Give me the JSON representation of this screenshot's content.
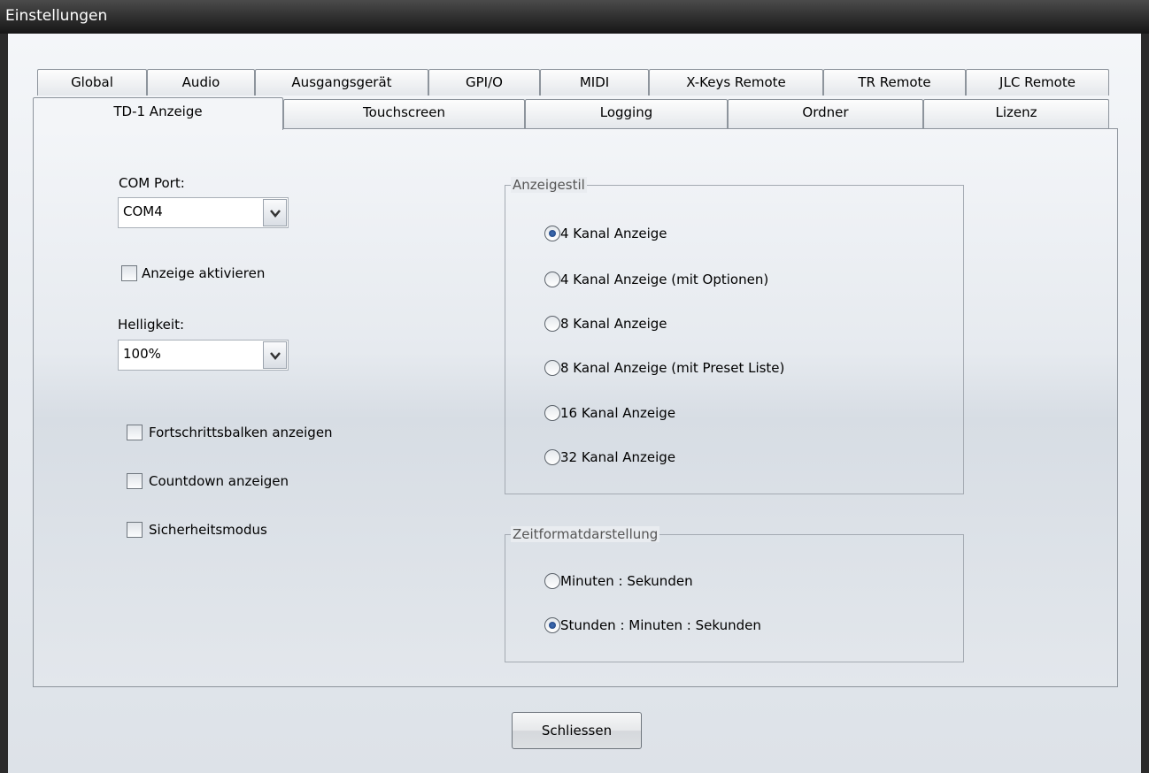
{
  "window": {
    "title": "Einstellungen"
  },
  "tabs_row1": [
    "Global",
    "Audio",
    "Ausgangsgerät",
    "GPI/O",
    "MIDI",
    "X-Keys Remote",
    "TR Remote",
    "JLC Remote"
  ],
  "tabs_row2": [
    "TD-1 Anzeige",
    "Touchscreen",
    "Logging",
    "Ordner",
    "Lizenz"
  ],
  "active_tab": "TD-1 Anzeige",
  "left": {
    "com_port_label": "COM Port:",
    "com_port_value": "COM4",
    "enable_display_label": "Anzeige aktivieren",
    "enable_display_checked": false,
    "brightness_label": "Helligkeit:",
    "brightness_value": "100%",
    "progress_bar_label": "Fortschrittsbalken anzeigen",
    "progress_bar_checked": false,
    "countdown_label": "Countdown anzeigen",
    "countdown_checked": false,
    "safety_mode_label": "Sicherheitsmodus",
    "safety_mode_checked": false
  },
  "display_style": {
    "legend": "Anzeigestil",
    "options": [
      "4 Kanal Anzeige",
      "4 Kanal Anzeige (mit Optionen)",
      "8 Kanal Anzeige",
      "8 Kanal Anzeige (mit Preset Liste)",
      "16 Kanal Anzeige",
      "32 Kanal Anzeige"
    ],
    "selected": "4 Kanal Anzeige"
  },
  "time_format": {
    "legend": "Zeitformatdarstellung",
    "options": [
      "Minuten : Sekunden",
      "Stunden : Minuten : Sekunden"
    ],
    "selected": "Stunden : Minuten : Sekunden"
  },
  "close_button_label": "Schliessen",
  "colors": {
    "title_bar": "#1e1e1e",
    "radio_dot": "#2b5597",
    "border": "#8d949c"
  }
}
